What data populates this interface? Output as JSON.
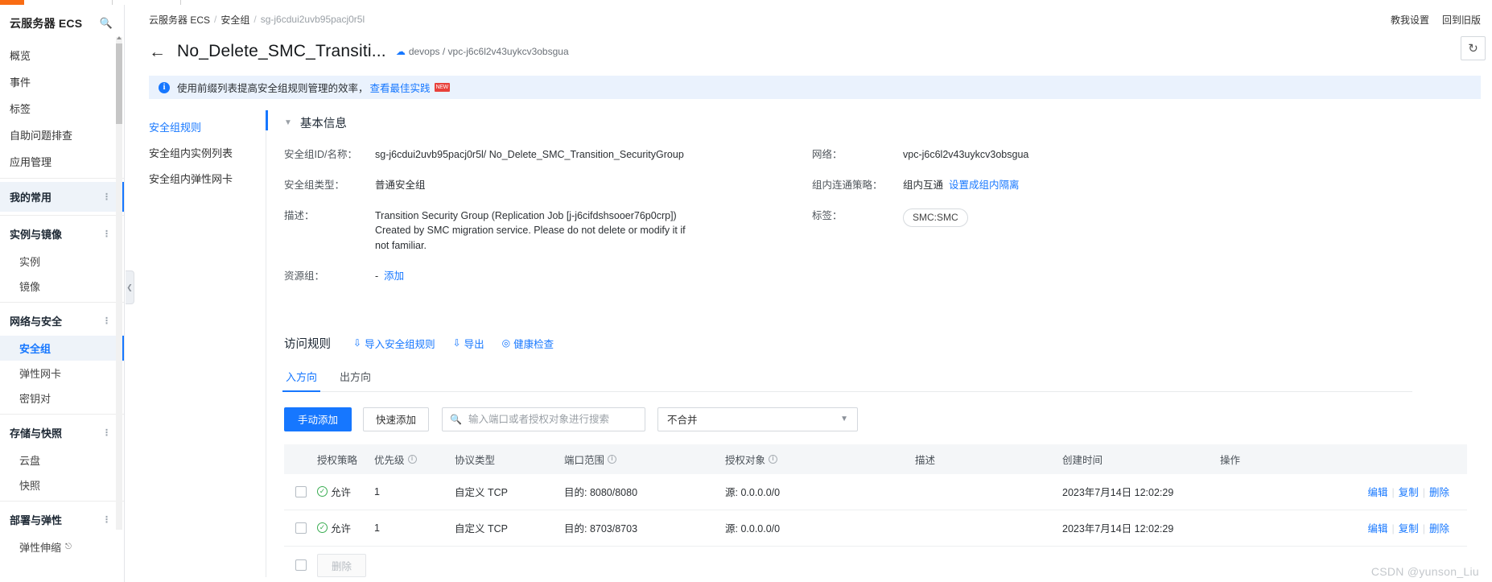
{
  "sidebar": {
    "brand": "云服务器 ECS",
    "search_icon": "search-icon",
    "top_items": [
      {
        "label": "概览"
      },
      {
        "label": "事件"
      },
      {
        "label": "标签"
      },
      {
        "label": "自助问题排查"
      },
      {
        "label": "应用管理"
      }
    ],
    "groups": [
      {
        "label": "我的常用",
        "active": true,
        "children": []
      },
      {
        "label": "实例与镜像",
        "active": false,
        "children": [
          {
            "label": "实例",
            "active": false
          },
          {
            "label": "镜像",
            "active": false
          }
        ]
      },
      {
        "label": "网络与安全",
        "active": false,
        "children": [
          {
            "label": "安全组",
            "active": true
          },
          {
            "label": "弹性网卡",
            "active": false
          },
          {
            "label": "密钥对",
            "active": false
          }
        ]
      },
      {
        "label": "存储与快照",
        "active": false,
        "children": [
          {
            "label": "云盘",
            "active": false
          },
          {
            "label": "快照",
            "active": false
          }
        ]
      },
      {
        "label": "部署与弹性",
        "active": false,
        "children": [
          {
            "label": "弹性伸缩",
            "active": false,
            "external": true
          }
        ]
      }
    ]
  },
  "header": {
    "breadcrumb": [
      {
        "label": "云服务器 ECS",
        "current": false
      },
      {
        "label": "安全组",
        "current": false
      },
      {
        "label": "sg-j6cdui2uvb95pacj0r5l",
        "current": true
      }
    ],
    "breadcrumb_sep": "/",
    "back_arrow": "←",
    "title": "No_Delete_SMC_Transiti...",
    "meta_vpc": "devops / vpc-j6c6l2v43uykcv3obsgua",
    "cloud_icon": "cloud-icon",
    "right_links": [
      "教我设置",
      "回到旧版"
    ],
    "refresh_icon": "refresh-icon"
  },
  "notice": {
    "icon": "info-icon",
    "text": "使用前缀列表提高安全组规则管理的效率，",
    "link": "查看最佳实践",
    "badge": "NEW"
  },
  "inner_nav": {
    "items": [
      {
        "label": "安全组规则",
        "active": true
      },
      {
        "label": "安全组内实例列表",
        "active": false
      },
      {
        "label": "安全组内弹性网卡",
        "active": false
      }
    ]
  },
  "basic_info": {
    "title": "基本信息",
    "collapse_icon": "chevron-down-icon",
    "left": [
      {
        "label": "安全组ID/名称：",
        "value": "sg-j6cdui2uvb95pacj0r5l/ No_Delete_SMC_Transition_SecurityGroup"
      },
      {
        "label": "安全组类型：",
        "value": "普通安全组"
      },
      {
        "label": "描述：",
        "value": "Transition Security Group (Replication Job [j-j6cifdshsooer76p0crp]) Created by SMC migration service. Please do not delete or modify it if not familiar."
      },
      {
        "label": "资源组：",
        "value": "-",
        "link": "添加"
      }
    ],
    "right": [
      {
        "label": "网络：",
        "value": "vpc-j6c6l2v43uykcv3obsgua"
      },
      {
        "label": "组内连通策略：",
        "value": "组内互通",
        "link": "设置成组内隔离"
      },
      {
        "label": "标签：",
        "tag": "SMC:SMC"
      }
    ]
  },
  "rules": {
    "title": "访问规则",
    "actions": [
      {
        "label": "导入安全组规则",
        "icon": "import-icon",
        "glyph": "⇩"
      },
      {
        "label": "导出",
        "icon": "export-icon",
        "glyph": "⇩"
      },
      {
        "label": "健康检查",
        "icon": "shield-check-icon",
        "glyph": "◎"
      }
    ],
    "tabs": [
      {
        "label": "入方向",
        "active": true
      },
      {
        "label": "出方向",
        "active": false
      }
    ],
    "toolbar": {
      "manual_add": "手动添加",
      "quick_add": "快速添加",
      "search_placeholder": "输入端口或者授权对象进行搜索",
      "search_value": "",
      "search_icon": "search-icon",
      "merge_select": "不合并",
      "chevron_icon": "chevron-down-icon"
    },
    "columns": [
      {
        "key": "policy",
        "label": "授权策略",
        "info": false
      },
      {
        "key": "priority",
        "label": "优先级",
        "info": true
      },
      {
        "key": "protocol",
        "label": "协议类型",
        "info": false
      },
      {
        "key": "port",
        "label": "端口范围",
        "info": true
      },
      {
        "key": "auth",
        "label": "授权对象",
        "info": true
      },
      {
        "key": "desc",
        "label": "描述",
        "info": false
      },
      {
        "key": "time",
        "label": "创建时间",
        "info": false
      },
      {
        "key": "ops",
        "label": "操作",
        "info": false
      }
    ],
    "rows": [
      {
        "policy": "允许",
        "priority": "1",
        "protocol": "自定义 TCP",
        "port": "目的: 8080/8080",
        "auth": "源: 0.0.0.0/0",
        "desc": "",
        "time": "2023年7月14日 12:02:29",
        "ops": [
          "编辑",
          "复制",
          "删除"
        ]
      },
      {
        "policy": "允许",
        "priority": "1",
        "protocol": "自定义 TCP",
        "port": "目的: 8703/8703",
        "auth": "源: 0.0.0.0/0",
        "desc": "",
        "time": "2023年7月14日 12:02:29",
        "ops": [
          "编辑",
          "复制",
          "删除"
        ]
      }
    ],
    "footer": {
      "delete_label": "删除"
    }
  },
  "watermark": "CSDN @yunson_Liu",
  "colors": {
    "accent": "#1677ff",
    "notice_bg": "#eaf2fd",
    "orange": "#f96c13",
    "success": "#3aad52"
  }
}
